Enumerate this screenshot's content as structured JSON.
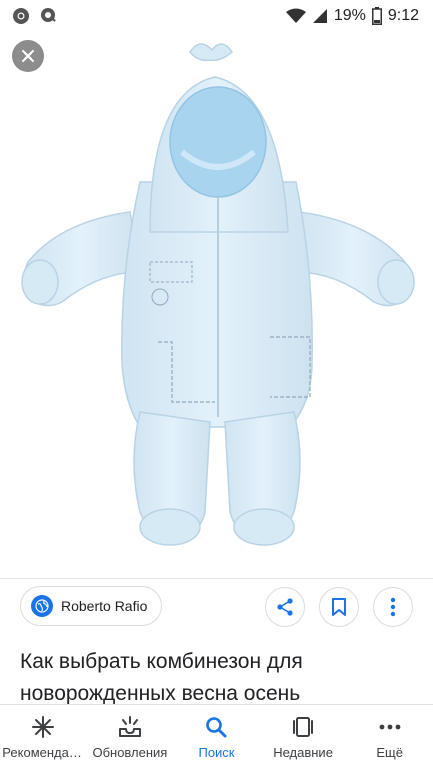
{
  "status_bar": {
    "battery_percent": "19%",
    "time": "9:12",
    "icons": [
      "chrome-icon",
      "notification-icon",
      "wifi-icon",
      "signal-icon",
      "battery-icon"
    ]
  },
  "viewer": {
    "close_icon": "close-icon",
    "image_subject": "baby-snowsuit-image"
  },
  "source": {
    "name": "Roberto Rafio",
    "icon": "globe-icon"
  },
  "actions": [
    {
      "icon": "share-icon"
    },
    {
      "icon": "bookmark-icon"
    },
    {
      "icon": "more-vert-icon"
    }
  ],
  "result": {
    "title": "Как выбрать комбинезон для новорожденных весна осень"
  },
  "bottom_nav": {
    "items": [
      {
        "label": "Рекомендации",
        "icon": "sparkle-icon",
        "active": false
      },
      {
        "label": "Обновления",
        "icon": "updates-icon",
        "active": false
      },
      {
        "label": "Поиск",
        "icon": "search-icon",
        "active": true
      },
      {
        "label": "Недавние",
        "icon": "recent-tabs-icon",
        "active": false
      },
      {
        "label": "Ещё",
        "icon": "more-horiz-icon",
        "active": false
      }
    ]
  },
  "colors": {
    "accent": "#1a73e8",
    "suit_light": "#d9ecf7",
    "suit_inner": "#a8d4f0"
  }
}
